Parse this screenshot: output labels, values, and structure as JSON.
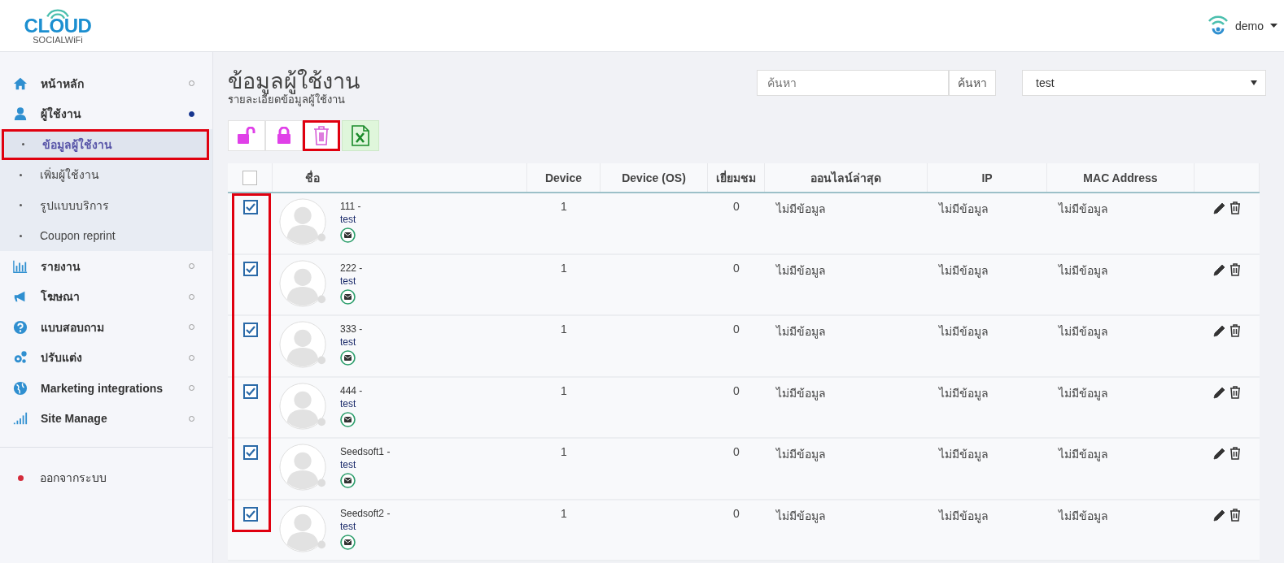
{
  "header": {
    "logo": {
      "title": "CLOUD",
      "subtitle": "SOCIALWiFi"
    },
    "user": "demo"
  },
  "sidebar": {
    "items": [
      {
        "label": "หน้าหลัก",
        "kind": "home",
        "selected": false
      },
      {
        "label": "ผู้ใช้งาน",
        "kind": "user",
        "selected": true,
        "expanded": true,
        "children": [
          {
            "label": "ข้อมูลผู้ใช้งาน",
            "selected": true,
            "highlighted": true
          },
          {
            "label": "เพิ่มผู้ใช้งาน",
            "selected": false,
            "highlighted": false
          },
          {
            "label": "รูปแบบบริการ",
            "selected": false,
            "highlighted": false
          },
          {
            "label": "Coupon reprint",
            "selected": false,
            "highlighted": false
          }
        ]
      },
      {
        "label": "รายงาน",
        "kind": "chart",
        "selected": false
      },
      {
        "label": "โฆษณา",
        "kind": "megaphone",
        "selected": false
      },
      {
        "label": "แบบสอบถาม",
        "kind": "question",
        "selected": false
      },
      {
        "label": "ปรับแต่ง",
        "kind": "gears",
        "selected": false
      },
      {
        "label": "Marketing integrations",
        "kind": "globe",
        "selected": false
      },
      {
        "label": "Site Manage",
        "kind": "signal",
        "selected": false
      }
    ],
    "logout": "ออกจากระบบ"
  },
  "page": {
    "title": "ข้อมูลผู้ใช้งาน",
    "subtitle": "รายละเอียดข้อมูลผู้ใช้งาน"
  },
  "search": {
    "placeholder": "ค้นหา",
    "button": "ค้นหา"
  },
  "site_select": {
    "value": "test"
  },
  "toolbar": [
    {
      "kind": "unlock",
      "highlighted": false
    },
    {
      "kind": "lock",
      "highlighted": false
    },
    {
      "kind": "delete",
      "highlighted": true
    },
    {
      "kind": "excel",
      "highlighted": false
    }
  ],
  "table": {
    "select_all_checked": false,
    "checkbox_column_highlighted": true,
    "columns": [
      "ชื่อ",
      "Device",
      "Device (OS)",
      "เยี่ยมชม",
      "ออนไลน์ล่าสุด",
      "IP",
      "MAC Address"
    ],
    "rows": [
      {
        "checked": true,
        "name": "111 -",
        "group": "test",
        "device": "1",
        "visits": "0",
        "last_online": "ไม่มีข้อมูล",
        "ip": "ไม่มีข้อมูล",
        "mac": "ไม่มีข้อมูล"
      },
      {
        "checked": true,
        "name": "222 -",
        "group": "test",
        "device": "1",
        "visits": "0",
        "last_online": "ไม่มีข้อมูล",
        "ip": "ไม่มีข้อมูล",
        "mac": "ไม่มีข้อมูล"
      },
      {
        "checked": true,
        "name": "333 -",
        "group": "test",
        "device": "1",
        "visits": "0",
        "last_online": "ไม่มีข้อมูล",
        "ip": "ไม่มีข้อมูล",
        "mac": "ไม่มีข้อมูล"
      },
      {
        "checked": true,
        "name": "444 -",
        "group": "test",
        "device": "1",
        "visits": "0",
        "last_online": "ไม่มีข้อมูล",
        "ip": "ไม่มีข้อมูล",
        "mac": "ไม่มีข้อมูล"
      },
      {
        "checked": true,
        "name": "Seedsoft1 -",
        "group": "test",
        "device": "1",
        "visits": "0",
        "last_online": "ไม่มีข้อมูล",
        "ip": "ไม่มีข้อมูล",
        "mac": "ไม่มีข้อมูล"
      },
      {
        "checked": true,
        "name": "Seedsoft2 -",
        "group": "test",
        "device": "1",
        "visits": "0",
        "last_online": "ไม่มีข้อมูล",
        "ip": "ไม่มีข้อมูล",
        "mac": "ไม่มีข้อมูล"
      }
    ]
  }
}
